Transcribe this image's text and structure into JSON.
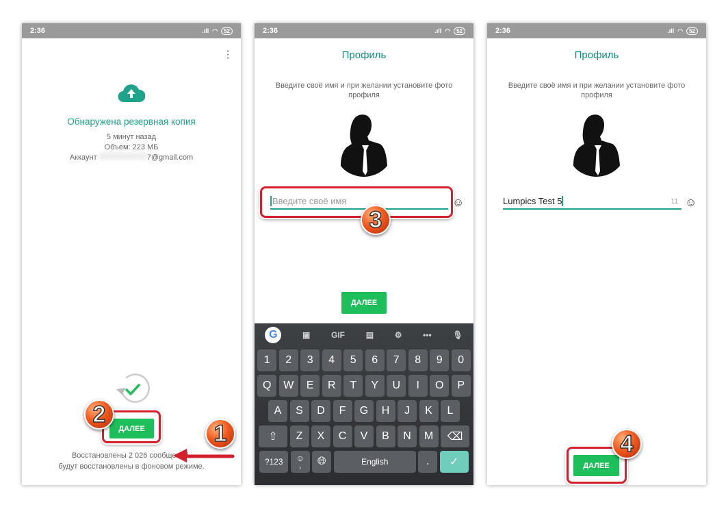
{
  "status": {
    "time": "2:36",
    "battery": "52"
  },
  "screen1": {
    "title": "Обнаружена резервная копия",
    "lines": [
      "5 минут назад",
      "Объем: 223 МБ"
    ],
    "account_label": "Аккаунт",
    "account_value": "7@gmail.com",
    "next_label": "ДАЛЕЕ",
    "footer": [
      "Восстановлены 2 026 сообщений.",
      "будут восстановлены в фоновом режиме."
    ]
  },
  "screen2": {
    "title": "Профиль",
    "subtitle": [
      "Введите своё имя и при желании установите фото",
      "профиля"
    ],
    "name_placeholder": "Введите своё имя",
    "next_label": "ДАЛЕЕ",
    "keyboard": {
      "toolbar": [
        "GIF"
      ],
      "rows": [
        [
          "1",
          "2",
          "3",
          "4",
          "5",
          "6",
          "7",
          "8",
          "9",
          "0"
        ],
        [
          "Q",
          "W",
          "E",
          "R",
          "T",
          "Y",
          "U",
          "I",
          "O",
          "P"
        ],
        [
          "A",
          "S",
          "D",
          "F",
          "G",
          "H",
          "J",
          "K",
          "L"
        ],
        [
          "Z",
          "X",
          "C",
          "V",
          "B",
          "N",
          "M"
        ]
      ],
      "symbols_key": "?123",
      "space_label": "English",
      "period": ".",
      "comma": ","
    }
  },
  "screen3": {
    "title": "Профиль",
    "subtitle": [
      "Введите своё имя и при желании установите фото",
      "профиля"
    ],
    "name_value": "Lumpics Test 5",
    "char_counter": "11",
    "next_label": "ДАЛЕЕ"
  },
  "badges": [
    "1",
    "2",
    "3",
    "4"
  ],
  "colors": {
    "accent": "#1fa38a",
    "button": "#1ebe5a",
    "highlight": "#d4202c",
    "status_bar": "#9a9a9a",
    "keyboard": "#3a3d40"
  }
}
